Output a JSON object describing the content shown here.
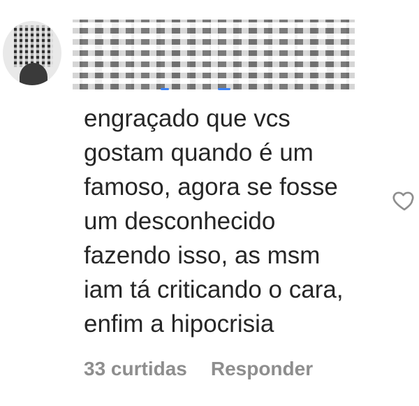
{
  "comment": {
    "text": "engraçado que vcs\ngostam quando é um\nfamoso, agora se fosse\num desconhecido\nfazendo isso, as msm\niam tá criticando o cara,\nenfim a hipocrisia",
    "likes_label": "33 curtidas",
    "reply_label": "Responder"
  },
  "icons": {
    "like": "heart-outline-icon"
  },
  "colors": {
    "text": "#262626",
    "meta": "#8e8e8e",
    "background": "#ffffff"
  }
}
